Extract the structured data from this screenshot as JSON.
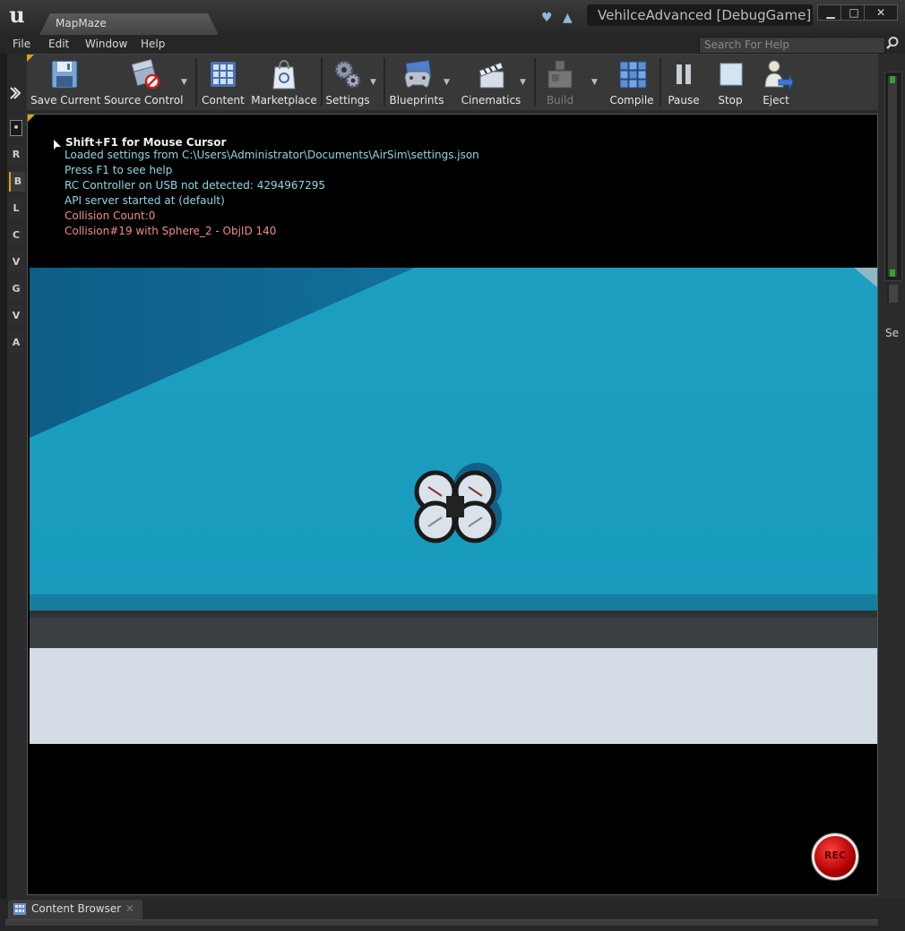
{
  "window": {
    "map_tab": "MapMaze",
    "project_title": "VehilceAdvanced [DebugGame]",
    "buttons": {
      "minimize": "▁",
      "maximize": "□",
      "close": "✕"
    }
  },
  "menu": [
    "File",
    "Edit",
    "Window",
    "Help"
  ],
  "search": {
    "placeholder": "Search For Help"
  },
  "left_tabs": [
    "R",
    "B",
    "L",
    "C",
    "V",
    "G",
    "V",
    "A"
  ],
  "toolbar": [
    {
      "label": "Save Current",
      "icon": "floppy-disk-icon",
      "dropdown": false,
      "enabled": true
    },
    {
      "label": "Source Control",
      "icon": "source-control-icon",
      "dropdown": true,
      "enabled": true
    },
    {
      "label": "Content",
      "icon": "content-grid-icon",
      "dropdown": false,
      "enabled": true
    },
    {
      "label": "Marketplace",
      "icon": "marketplace-bag-icon",
      "dropdown": false,
      "enabled": true
    },
    {
      "label": "Settings",
      "icon": "gears-icon",
      "dropdown": true,
      "enabled": true
    },
    {
      "label": "Blueprints",
      "icon": "gamepad-icon",
      "dropdown": true,
      "enabled": true
    },
    {
      "label": "Cinematics",
      "icon": "clapperboard-icon",
      "dropdown": true,
      "enabled": true
    },
    {
      "label": "Build",
      "icon": "build-blocks-icon",
      "dropdown": true,
      "enabled": false
    },
    {
      "label": "Compile",
      "icon": "compile-cubes-icon",
      "dropdown": false,
      "enabled": true
    },
    {
      "label": "Pause",
      "icon": "pause-icon",
      "dropdown": false,
      "enabled": true
    },
    {
      "label": "Stop",
      "icon": "stop-icon",
      "dropdown": false,
      "enabled": true
    },
    {
      "label": "Eject",
      "icon": "eject-person-icon",
      "dropdown": false,
      "enabled": true
    }
  ],
  "log": {
    "header": "Shift+F1 for Mouse Cursor",
    "lines": [
      {
        "text": "Loaded settings from C:\\Users\\Administrator\\Documents\\AirSim\\settings.json",
        "color": "#8fd6e6"
      },
      {
        "text": "Press F1 to see help",
        "color": "#8fd6e6"
      },
      {
        "text": "RC Controller on USB not detected: 4294967295",
        "color": "#8fd6e6"
      },
      {
        "text": "API server started at (default)",
        "color": "#8fd6e6"
      },
      {
        "text": "Collision Count:0",
        "color": "#f08c8c"
      },
      {
        "text": "Collision#19 with Sphere_2 - ObjID 140",
        "color": "#f08c8c"
      }
    ]
  },
  "rec_label": "REC",
  "right_panel_label": "Se",
  "bottom_tab": "Content Browser",
  "colors": {
    "accent": "#d8a020",
    "floor": "#1a9cbd",
    "rec": "#c80000"
  }
}
